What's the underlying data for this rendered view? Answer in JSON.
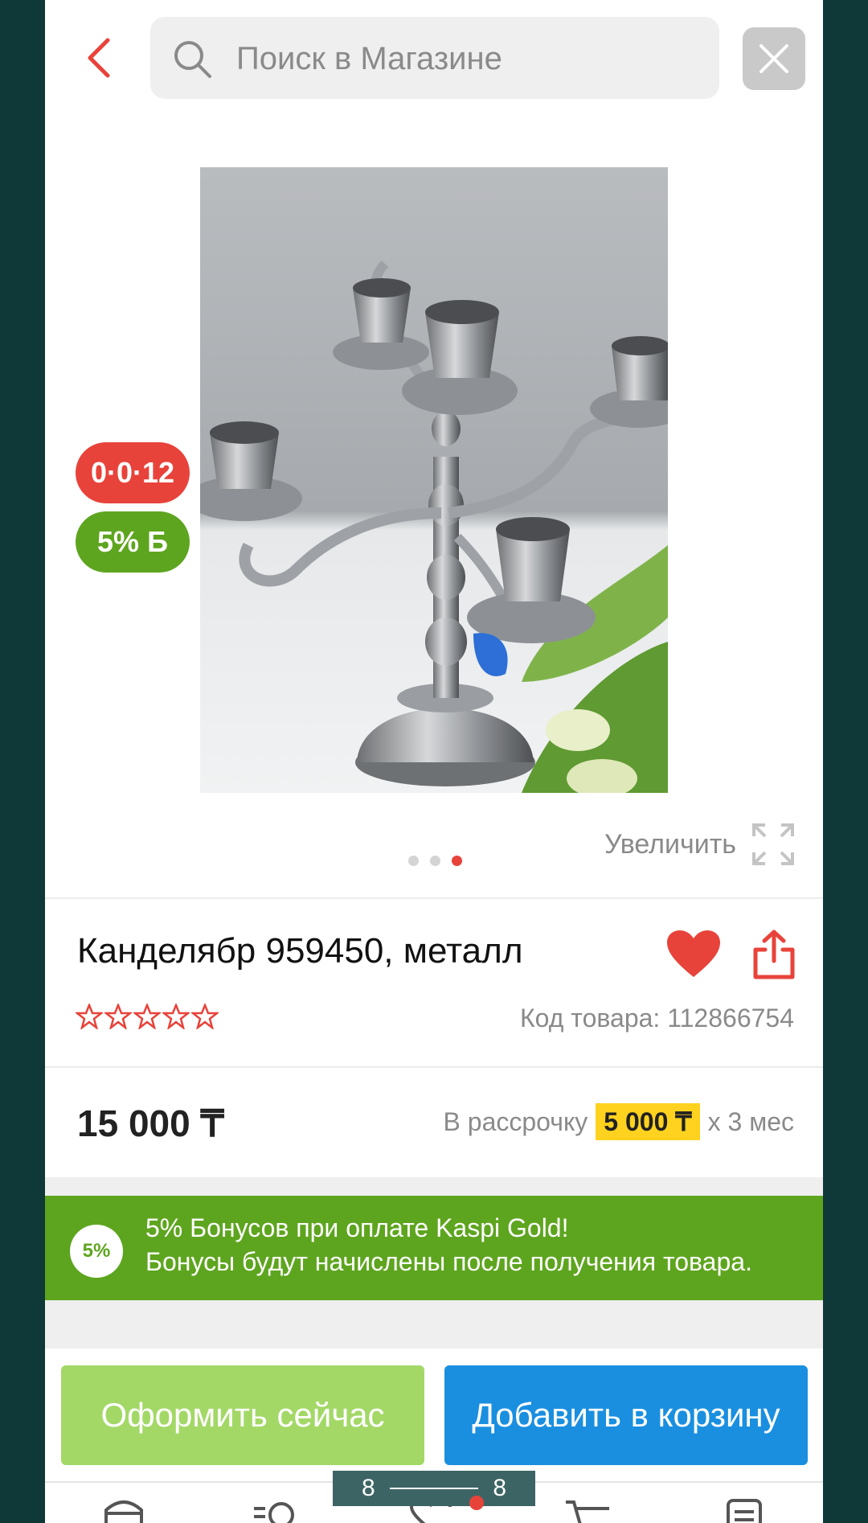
{
  "header": {
    "search_placeholder": "Поиск в Магазине"
  },
  "product": {
    "badge_installment": "0·0·12",
    "badge_bonus": "5% Б",
    "zoom_label": "Увеличить",
    "title": "Канделябр 959450, металл",
    "rating_stars": 0,
    "code": "Код товара: 112866754",
    "price": "15 000 ₸",
    "installment_prefix": "В рассрочку",
    "installment_amount": "5 000 ₸",
    "installment_suffix": "х 3 мес",
    "image_count": 3,
    "active_image": 3
  },
  "bonus": {
    "badge": "5%",
    "line1": "5% Бонусов при оплате Kaspi Gold!",
    "line2": "Бонусы будут начислены после получения товара."
  },
  "actions": {
    "buy_now": "Оформить сейчас",
    "add_to_cart": "Добавить в корзину"
  },
  "pager": {
    "left": "8",
    "right": "8"
  },
  "colors": {
    "accent_red": "#e8433a",
    "bonus_green": "#5ea51f",
    "buy_now_green": "#a3d867",
    "cart_blue": "#1a8fe0",
    "installment_yellow": "#ffd21f"
  },
  "icons": [
    "back-chevron-icon",
    "search-icon",
    "close-icon",
    "heart-icon",
    "share-icon",
    "expand-icon",
    "star-icon",
    "store-icon",
    "catalog-search-icon",
    "favorites-icon",
    "cart-icon",
    "orders-icon"
  ]
}
